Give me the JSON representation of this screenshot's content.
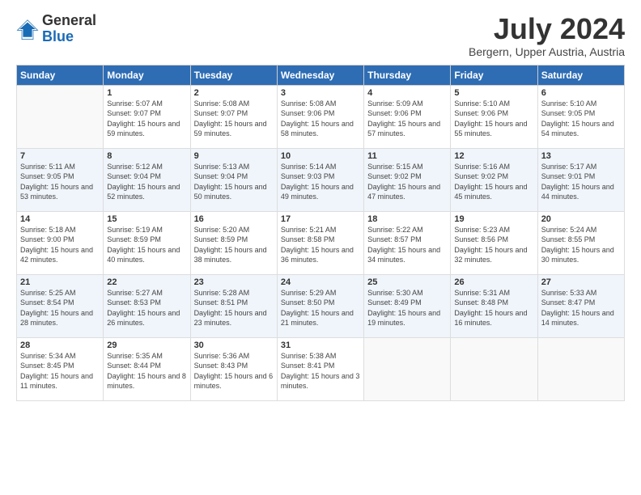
{
  "logo": {
    "line1": "General",
    "line2": "Blue"
  },
  "title": "July 2024",
  "subtitle": "Bergern, Upper Austria, Austria",
  "days_of_week": [
    "Sunday",
    "Monday",
    "Tuesday",
    "Wednesday",
    "Thursday",
    "Friday",
    "Saturday"
  ],
  "weeks": [
    [
      {
        "day": "",
        "sunrise": "",
        "sunset": "",
        "daylight": ""
      },
      {
        "day": "1",
        "sunrise": "Sunrise: 5:07 AM",
        "sunset": "Sunset: 9:07 PM",
        "daylight": "Daylight: 15 hours and 59 minutes."
      },
      {
        "day": "2",
        "sunrise": "Sunrise: 5:08 AM",
        "sunset": "Sunset: 9:07 PM",
        "daylight": "Daylight: 15 hours and 59 minutes."
      },
      {
        "day": "3",
        "sunrise": "Sunrise: 5:08 AM",
        "sunset": "Sunset: 9:06 PM",
        "daylight": "Daylight: 15 hours and 58 minutes."
      },
      {
        "day": "4",
        "sunrise": "Sunrise: 5:09 AM",
        "sunset": "Sunset: 9:06 PM",
        "daylight": "Daylight: 15 hours and 57 minutes."
      },
      {
        "day": "5",
        "sunrise": "Sunrise: 5:10 AM",
        "sunset": "Sunset: 9:06 PM",
        "daylight": "Daylight: 15 hours and 55 minutes."
      },
      {
        "day": "6",
        "sunrise": "Sunrise: 5:10 AM",
        "sunset": "Sunset: 9:05 PM",
        "daylight": "Daylight: 15 hours and 54 minutes."
      }
    ],
    [
      {
        "day": "7",
        "sunrise": "Sunrise: 5:11 AM",
        "sunset": "Sunset: 9:05 PM",
        "daylight": "Daylight: 15 hours and 53 minutes."
      },
      {
        "day": "8",
        "sunrise": "Sunrise: 5:12 AM",
        "sunset": "Sunset: 9:04 PM",
        "daylight": "Daylight: 15 hours and 52 minutes."
      },
      {
        "day": "9",
        "sunrise": "Sunrise: 5:13 AM",
        "sunset": "Sunset: 9:04 PM",
        "daylight": "Daylight: 15 hours and 50 minutes."
      },
      {
        "day": "10",
        "sunrise": "Sunrise: 5:14 AM",
        "sunset": "Sunset: 9:03 PM",
        "daylight": "Daylight: 15 hours and 49 minutes."
      },
      {
        "day": "11",
        "sunrise": "Sunrise: 5:15 AM",
        "sunset": "Sunset: 9:02 PM",
        "daylight": "Daylight: 15 hours and 47 minutes."
      },
      {
        "day": "12",
        "sunrise": "Sunrise: 5:16 AM",
        "sunset": "Sunset: 9:02 PM",
        "daylight": "Daylight: 15 hours and 45 minutes."
      },
      {
        "day": "13",
        "sunrise": "Sunrise: 5:17 AM",
        "sunset": "Sunset: 9:01 PM",
        "daylight": "Daylight: 15 hours and 44 minutes."
      }
    ],
    [
      {
        "day": "14",
        "sunrise": "Sunrise: 5:18 AM",
        "sunset": "Sunset: 9:00 PM",
        "daylight": "Daylight: 15 hours and 42 minutes."
      },
      {
        "day": "15",
        "sunrise": "Sunrise: 5:19 AM",
        "sunset": "Sunset: 8:59 PM",
        "daylight": "Daylight: 15 hours and 40 minutes."
      },
      {
        "day": "16",
        "sunrise": "Sunrise: 5:20 AM",
        "sunset": "Sunset: 8:59 PM",
        "daylight": "Daylight: 15 hours and 38 minutes."
      },
      {
        "day": "17",
        "sunrise": "Sunrise: 5:21 AM",
        "sunset": "Sunset: 8:58 PM",
        "daylight": "Daylight: 15 hours and 36 minutes."
      },
      {
        "day": "18",
        "sunrise": "Sunrise: 5:22 AM",
        "sunset": "Sunset: 8:57 PM",
        "daylight": "Daylight: 15 hours and 34 minutes."
      },
      {
        "day": "19",
        "sunrise": "Sunrise: 5:23 AM",
        "sunset": "Sunset: 8:56 PM",
        "daylight": "Daylight: 15 hours and 32 minutes."
      },
      {
        "day": "20",
        "sunrise": "Sunrise: 5:24 AM",
        "sunset": "Sunset: 8:55 PM",
        "daylight": "Daylight: 15 hours and 30 minutes."
      }
    ],
    [
      {
        "day": "21",
        "sunrise": "Sunrise: 5:25 AM",
        "sunset": "Sunset: 8:54 PM",
        "daylight": "Daylight: 15 hours and 28 minutes."
      },
      {
        "day": "22",
        "sunrise": "Sunrise: 5:27 AM",
        "sunset": "Sunset: 8:53 PM",
        "daylight": "Daylight: 15 hours and 26 minutes."
      },
      {
        "day": "23",
        "sunrise": "Sunrise: 5:28 AM",
        "sunset": "Sunset: 8:51 PM",
        "daylight": "Daylight: 15 hours and 23 minutes."
      },
      {
        "day": "24",
        "sunrise": "Sunrise: 5:29 AM",
        "sunset": "Sunset: 8:50 PM",
        "daylight": "Daylight: 15 hours and 21 minutes."
      },
      {
        "day": "25",
        "sunrise": "Sunrise: 5:30 AM",
        "sunset": "Sunset: 8:49 PM",
        "daylight": "Daylight: 15 hours and 19 minutes."
      },
      {
        "day": "26",
        "sunrise": "Sunrise: 5:31 AM",
        "sunset": "Sunset: 8:48 PM",
        "daylight": "Daylight: 15 hours and 16 minutes."
      },
      {
        "day": "27",
        "sunrise": "Sunrise: 5:33 AM",
        "sunset": "Sunset: 8:47 PM",
        "daylight": "Daylight: 15 hours and 14 minutes."
      }
    ],
    [
      {
        "day": "28",
        "sunrise": "Sunrise: 5:34 AM",
        "sunset": "Sunset: 8:45 PM",
        "daylight": "Daylight: 15 hours and 11 minutes."
      },
      {
        "day": "29",
        "sunrise": "Sunrise: 5:35 AM",
        "sunset": "Sunset: 8:44 PM",
        "daylight": "Daylight: 15 hours and 8 minutes."
      },
      {
        "day": "30",
        "sunrise": "Sunrise: 5:36 AM",
        "sunset": "Sunset: 8:43 PM",
        "daylight": "Daylight: 15 hours and 6 minutes."
      },
      {
        "day": "31",
        "sunrise": "Sunrise: 5:38 AM",
        "sunset": "Sunset: 8:41 PM",
        "daylight": "Daylight: 15 hours and 3 minutes."
      },
      {
        "day": "",
        "sunrise": "",
        "sunset": "",
        "daylight": ""
      },
      {
        "day": "",
        "sunrise": "",
        "sunset": "",
        "daylight": ""
      },
      {
        "day": "",
        "sunrise": "",
        "sunset": "",
        "daylight": ""
      }
    ]
  ]
}
